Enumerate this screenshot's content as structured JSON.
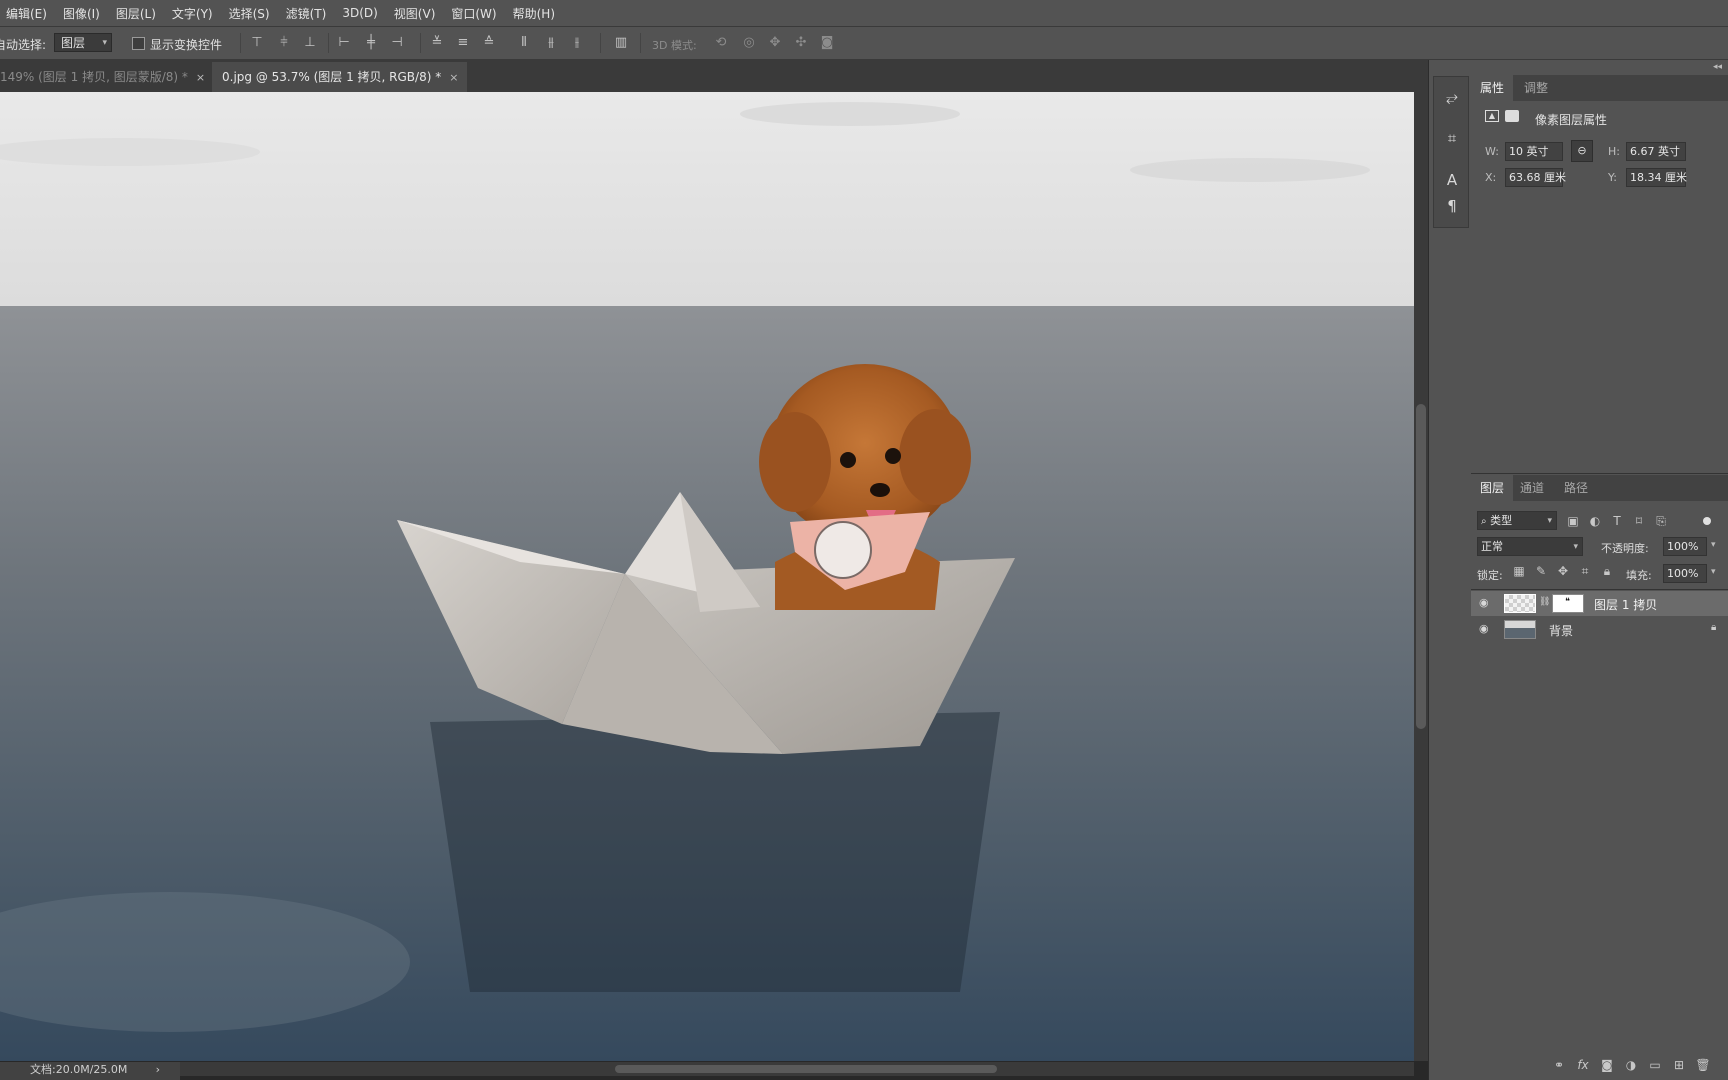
{
  "menu": [
    "编辑(E)",
    "图像(I)",
    "图层(L)",
    "文字(Y)",
    "选择(S)",
    "滤镜(T)",
    "3D(D)",
    "视图(V)",
    "窗口(W)",
    "帮助(H)"
  ],
  "options": {
    "auto_select_label": "自动选择:",
    "auto_select_value": "图层",
    "show_transform_label": "显示变换控件",
    "mode3d_label": "3D 模式:"
  },
  "tabs": [
    {
      "label": "149% (图层 1 拷贝, 图层蒙版/8) *",
      "close": "×"
    },
    {
      "label": "0.jpg @ 53.7% (图层 1 拷贝, RGB/8) *",
      "close": "×"
    }
  ],
  "status": {
    "doc": "文档:20.0M/25.0M",
    "arrow": "›"
  },
  "properties": {
    "tabs": [
      "属性",
      "调整"
    ],
    "title": "像素图层属性",
    "w_label": "W:",
    "w_value": "10 英寸",
    "h_label": "H:",
    "h_value": "6.67 英寸",
    "x_label": "X:",
    "x_value": "63.68 厘米",
    "y_label": "Y:",
    "y_value": "18.34 厘米"
  },
  "layers": {
    "tabs": [
      "图层",
      "通道",
      "路径"
    ],
    "filter_label": "类型",
    "blend_mode": "正常",
    "opacity_label": "不透明度:",
    "opacity_value": "100%",
    "lock_label": "锁定:",
    "fill_label": "填充:",
    "fill_value": "100%",
    "items": [
      {
        "name": "图层 1 拷贝",
        "selected": true
      },
      {
        "name": "背景",
        "selected": false
      }
    ]
  },
  "colors": {
    "panel": "#535353",
    "dark": "#282828",
    "selected_layer": "#6b6b6b"
  }
}
